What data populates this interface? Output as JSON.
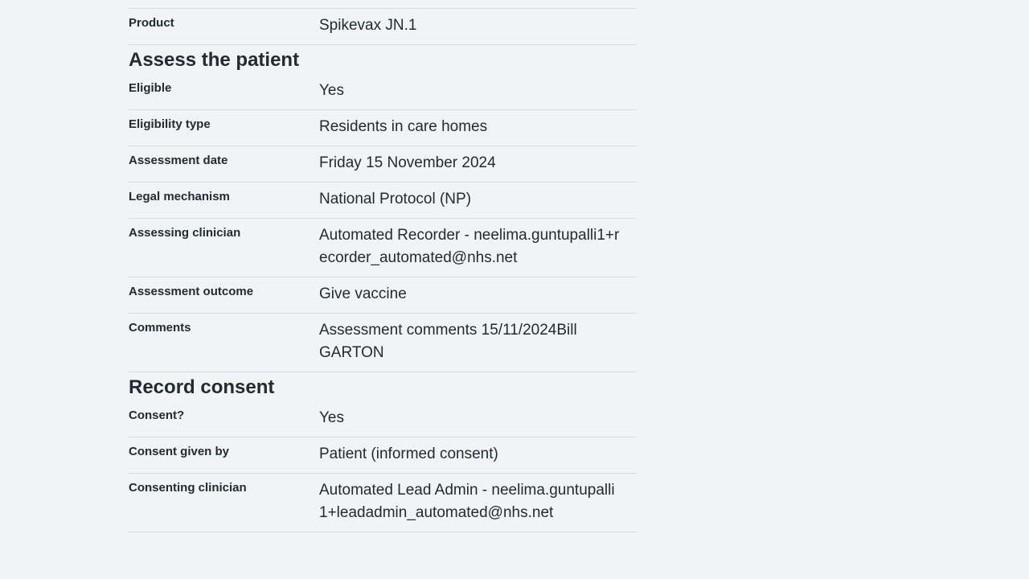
{
  "top_row": {
    "key": "Product",
    "value": "Spikevax JN.1"
  },
  "assess": {
    "heading": "Assess the patient",
    "rows": [
      {
        "key": "Eligible",
        "value": "Yes"
      },
      {
        "key": "Eligibility type",
        "value": "Residents in care homes"
      },
      {
        "key": "Assessment date",
        "value": "Friday 15 November 2024"
      },
      {
        "key": "Legal mechanism",
        "value": "National Protocol (NP)"
      },
      {
        "key": "Assessing clinician",
        "value": "Automated Recorder - neelima.guntupalli1+recorder_automated@nhs.net"
      },
      {
        "key": "Assessment outcome",
        "value": "Give vaccine"
      },
      {
        "key": "Comments",
        "value": "Assessment comments 15/11/2024Bill GARTON"
      }
    ]
  },
  "consent": {
    "heading": "Record consent",
    "rows": [
      {
        "key": "Consent?",
        "value": "Yes"
      },
      {
        "key": "Consent given by",
        "value": "Patient (informed consent)"
      },
      {
        "key": "Consenting clinician",
        "value": "Automated Lead Admin - neelima.guntupalli1+leadadmin_automated@nhs.net"
      }
    ]
  }
}
